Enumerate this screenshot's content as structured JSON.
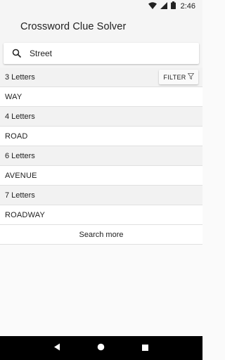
{
  "status_bar": {
    "time": "2:46"
  },
  "app": {
    "title": "Crossword Clue Solver"
  },
  "search": {
    "value": "Street",
    "placeholder": ""
  },
  "filter": {
    "label": "FILTER"
  },
  "groups": [
    {
      "header": "3 Letters",
      "words": [
        "WAY"
      ]
    },
    {
      "header": "4 Letters",
      "words": [
        "ROAD"
      ]
    },
    {
      "header": "6 Letters",
      "words": [
        "AVENUE"
      ]
    },
    {
      "header": "7 Letters",
      "words": [
        "ROADWAY"
      ]
    }
  ],
  "search_more": "Search more",
  "icons": {
    "search": "search-icon",
    "filter": "filter-icon",
    "back": "nav-back-icon",
    "home": "nav-home-icon",
    "recents": "nav-recents-icon"
  }
}
